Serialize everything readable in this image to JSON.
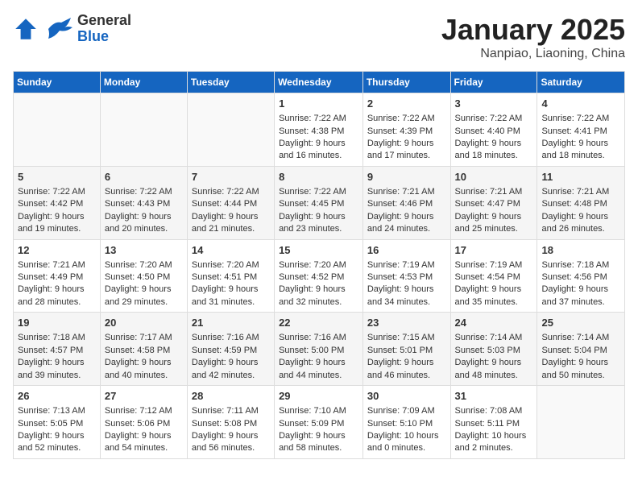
{
  "logo": {
    "general": "General",
    "blue": "Blue"
  },
  "title": "January 2025",
  "subtitle": "Nanpiao, Liaoning, China",
  "days_of_week": [
    "Sunday",
    "Monday",
    "Tuesday",
    "Wednesday",
    "Thursday",
    "Friday",
    "Saturday"
  ],
  "weeks": [
    [
      {
        "day": "",
        "text": ""
      },
      {
        "day": "",
        "text": ""
      },
      {
        "day": "",
        "text": ""
      },
      {
        "day": "1",
        "text": "Sunrise: 7:22 AM\nSunset: 4:38 PM\nDaylight: 9 hours and 16 minutes."
      },
      {
        "day": "2",
        "text": "Sunrise: 7:22 AM\nSunset: 4:39 PM\nDaylight: 9 hours and 17 minutes."
      },
      {
        "day": "3",
        "text": "Sunrise: 7:22 AM\nSunset: 4:40 PM\nDaylight: 9 hours and 18 minutes."
      },
      {
        "day": "4",
        "text": "Sunrise: 7:22 AM\nSunset: 4:41 PM\nDaylight: 9 hours and 18 minutes."
      }
    ],
    [
      {
        "day": "5",
        "text": "Sunrise: 7:22 AM\nSunset: 4:42 PM\nDaylight: 9 hours and 19 minutes."
      },
      {
        "day": "6",
        "text": "Sunrise: 7:22 AM\nSunset: 4:43 PM\nDaylight: 9 hours and 20 minutes."
      },
      {
        "day": "7",
        "text": "Sunrise: 7:22 AM\nSunset: 4:44 PM\nDaylight: 9 hours and 21 minutes."
      },
      {
        "day": "8",
        "text": "Sunrise: 7:22 AM\nSunset: 4:45 PM\nDaylight: 9 hours and 23 minutes."
      },
      {
        "day": "9",
        "text": "Sunrise: 7:21 AM\nSunset: 4:46 PM\nDaylight: 9 hours and 24 minutes."
      },
      {
        "day": "10",
        "text": "Sunrise: 7:21 AM\nSunset: 4:47 PM\nDaylight: 9 hours and 25 minutes."
      },
      {
        "day": "11",
        "text": "Sunrise: 7:21 AM\nSunset: 4:48 PM\nDaylight: 9 hours and 26 minutes."
      }
    ],
    [
      {
        "day": "12",
        "text": "Sunrise: 7:21 AM\nSunset: 4:49 PM\nDaylight: 9 hours and 28 minutes."
      },
      {
        "day": "13",
        "text": "Sunrise: 7:20 AM\nSunset: 4:50 PM\nDaylight: 9 hours and 29 minutes."
      },
      {
        "day": "14",
        "text": "Sunrise: 7:20 AM\nSunset: 4:51 PM\nDaylight: 9 hours and 31 minutes."
      },
      {
        "day": "15",
        "text": "Sunrise: 7:20 AM\nSunset: 4:52 PM\nDaylight: 9 hours and 32 minutes."
      },
      {
        "day": "16",
        "text": "Sunrise: 7:19 AM\nSunset: 4:53 PM\nDaylight: 9 hours and 34 minutes."
      },
      {
        "day": "17",
        "text": "Sunrise: 7:19 AM\nSunset: 4:54 PM\nDaylight: 9 hours and 35 minutes."
      },
      {
        "day": "18",
        "text": "Sunrise: 7:18 AM\nSunset: 4:56 PM\nDaylight: 9 hours and 37 minutes."
      }
    ],
    [
      {
        "day": "19",
        "text": "Sunrise: 7:18 AM\nSunset: 4:57 PM\nDaylight: 9 hours and 39 minutes."
      },
      {
        "day": "20",
        "text": "Sunrise: 7:17 AM\nSunset: 4:58 PM\nDaylight: 9 hours and 40 minutes."
      },
      {
        "day": "21",
        "text": "Sunrise: 7:16 AM\nSunset: 4:59 PM\nDaylight: 9 hours and 42 minutes."
      },
      {
        "day": "22",
        "text": "Sunrise: 7:16 AM\nSunset: 5:00 PM\nDaylight: 9 hours and 44 minutes."
      },
      {
        "day": "23",
        "text": "Sunrise: 7:15 AM\nSunset: 5:01 PM\nDaylight: 9 hours and 46 minutes."
      },
      {
        "day": "24",
        "text": "Sunrise: 7:14 AM\nSunset: 5:03 PM\nDaylight: 9 hours and 48 minutes."
      },
      {
        "day": "25",
        "text": "Sunrise: 7:14 AM\nSunset: 5:04 PM\nDaylight: 9 hours and 50 minutes."
      }
    ],
    [
      {
        "day": "26",
        "text": "Sunrise: 7:13 AM\nSunset: 5:05 PM\nDaylight: 9 hours and 52 minutes."
      },
      {
        "day": "27",
        "text": "Sunrise: 7:12 AM\nSunset: 5:06 PM\nDaylight: 9 hours and 54 minutes."
      },
      {
        "day": "28",
        "text": "Sunrise: 7:11 AM\nSunset: 5:08 PM\nDaylight: 9 hours and 56 minutes."
      },
      {
        "day": "29",
        "text": "Sunrise: 7:10 AM\nSunset: 5:09 PM\nDaylight: 9 hours and 58 minutes."
      },
      {
        "day": "30",
        "text": "Sunrise: 7:09 AM\nSunset: 5:10 PM\nDaylight: 10 hours and 0 minutes."
      },
      {
        "day": "31",
        "text": "Sunrise: 7:08 AM\nSunset: 5:11 PM\nDaylight: 10 hours and 2 minutes."
      },
      {
        "day": "",
        "text": ""
      }
    ]
  ]
}
